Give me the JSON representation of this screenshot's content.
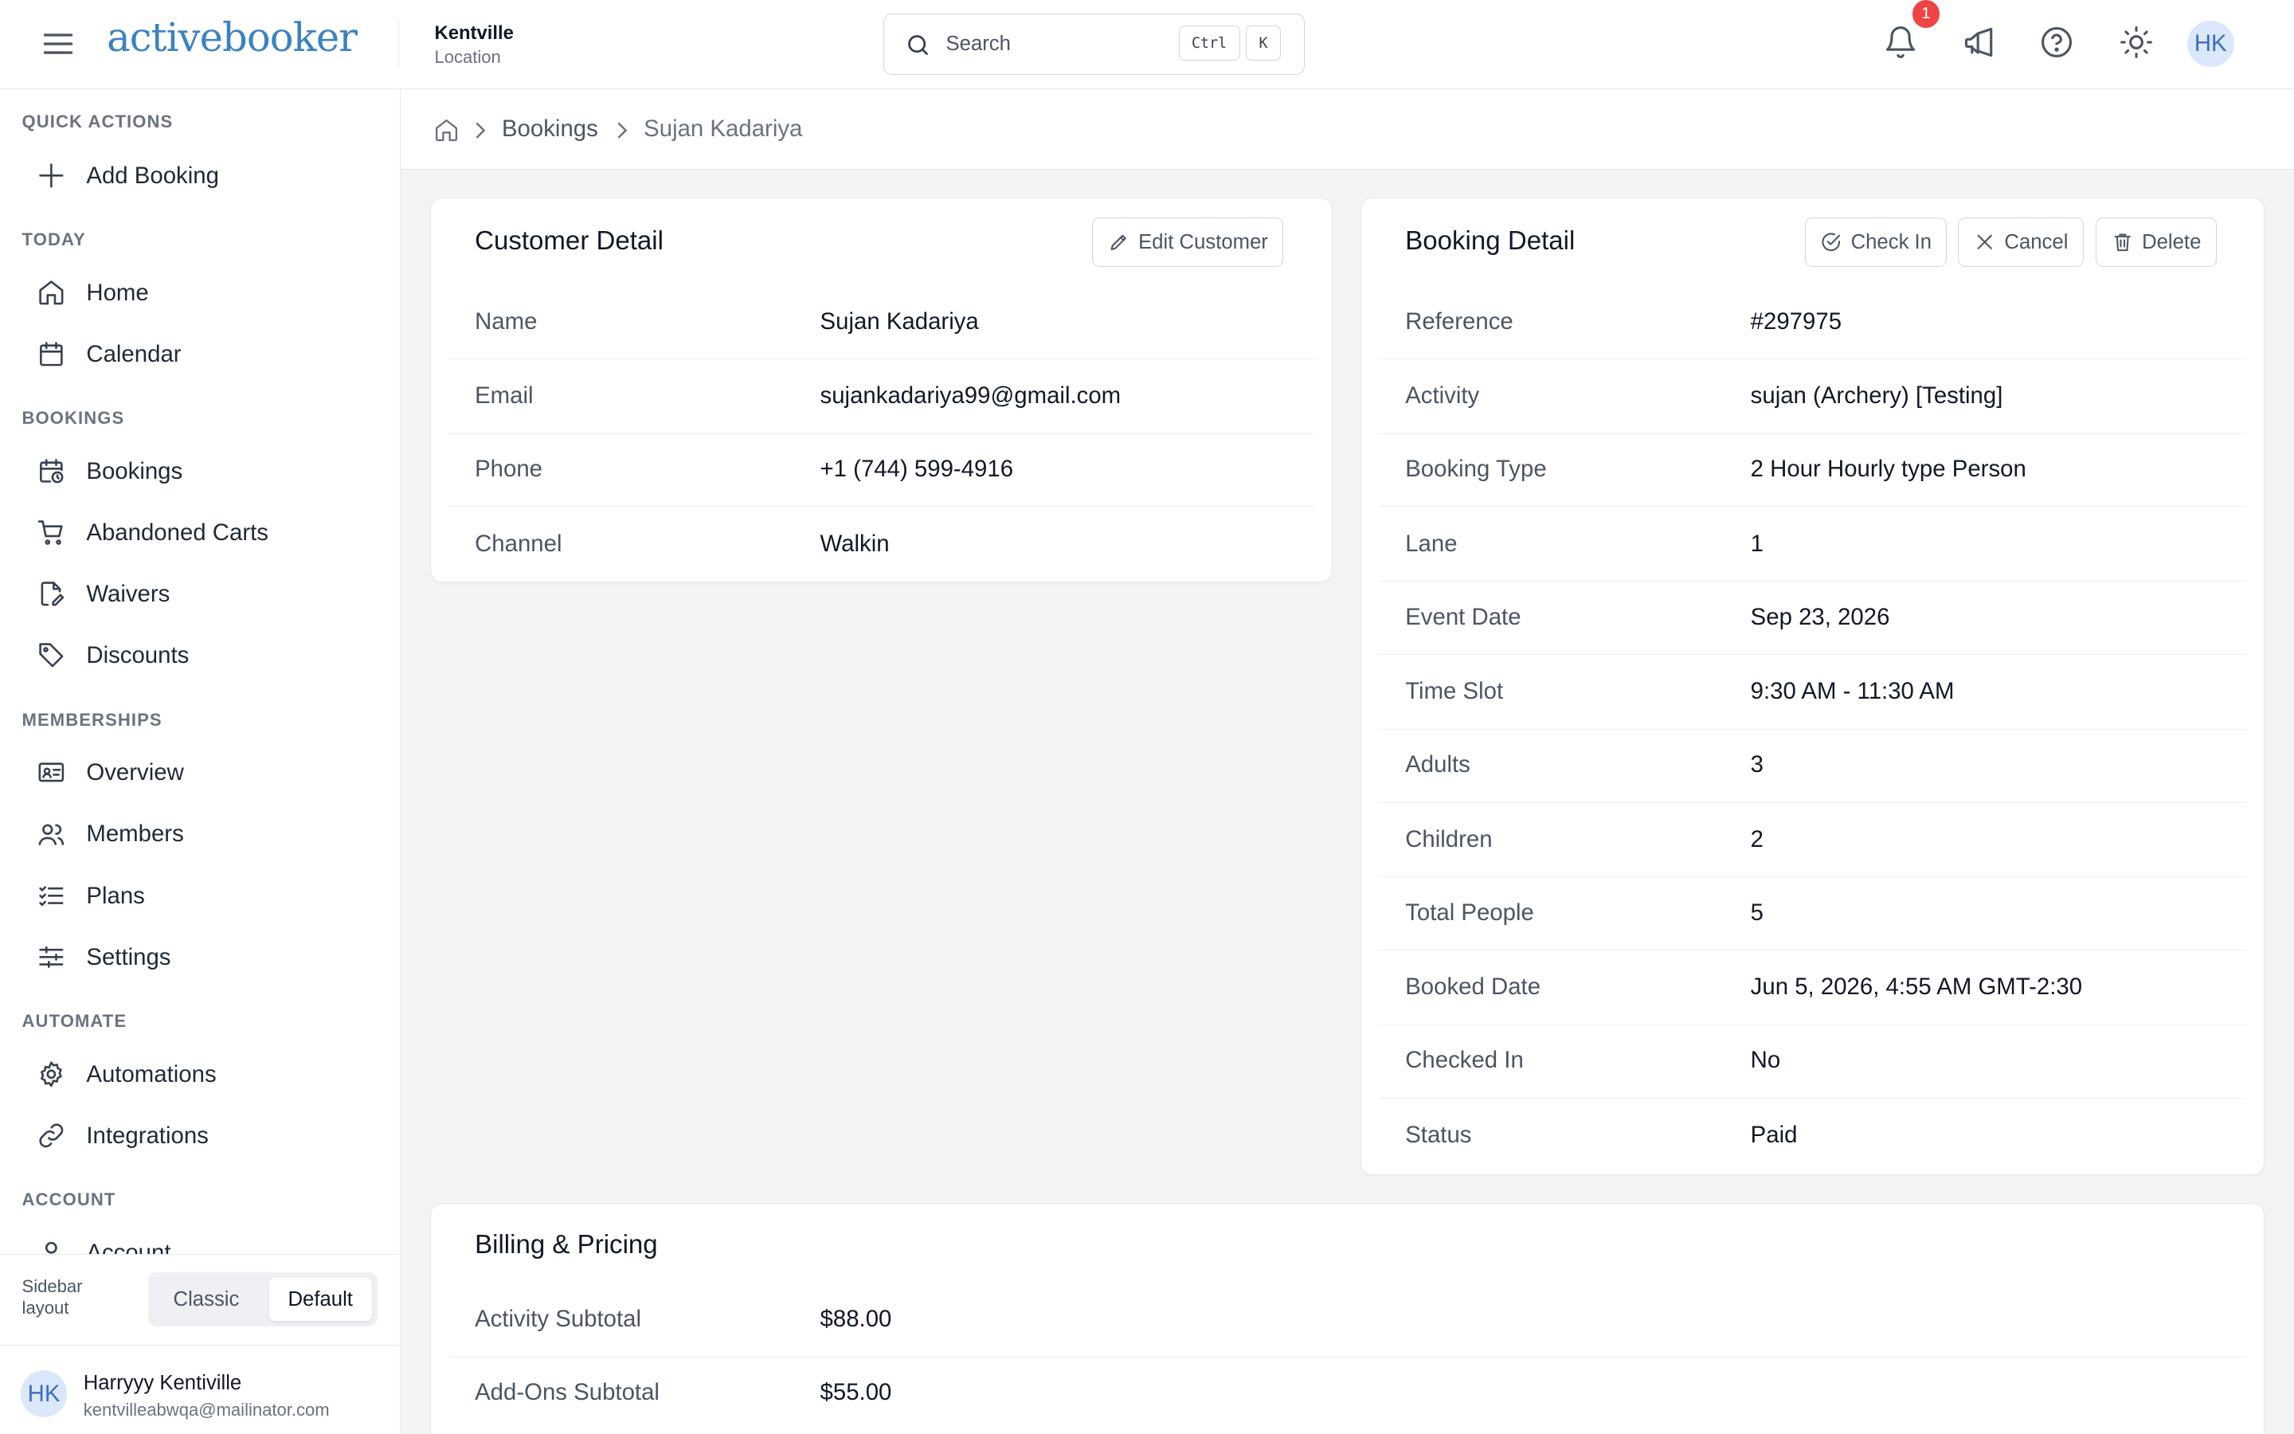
{
  "header": {
    "logo": "activebooker",
    "location_name": "Kentville",
    "location_label": "Location",
    "search_placeholder": "Search",
    "shortcut_ctrl": "Ctrl",
    "shortcut_key": "K",
    "notification_count": "1",
    "avatar_initials": "HK"
  },
  "sidebar": {
    "sections": [
      {
        "title": "QUICK ACTIONS",
        "items": [
          {
            "label": "Add Booking",
            "icon": "plus-icon"
          }
        ]
      },
      {
        "title": "TODAY",
        "items": [
          {
            "label": "Home",
            "icon": "home-icon"
          },
          {
            "label": "Calendar",
            "icon": "calendar-icon"
          }
        ]
      },
      {
        "title": "BOOKINGS",
        "items": [
          {
            "label": "Bookings",
            "icon": "calendar-clock-icon"
          },
          {
            "label": "Abandoned Carts",
            "icon": "cart-icon"
          },
          {
            "label": "Waivers",
            "icon": "file-signature-icon"
          },
          {
            "label": "Discounts",
            "icon": "tag-icon"
          }
        ]
      },
      {
        "title": "MEMBERSHIPS",
        "items": [
          {
            "label": "Overview",
            "icon": "id-card-icon"
          },
          {
            "label": "Members",
            "icon": "users-icon"
          },
          {
            "label": "Plans",
            "icon": "list-check-icon"
          },
          {
            "label": "Settings",
            "icon": "sliders-icon"
          }
        ]
      },
      {
        "title": "AUTOMATE",
        "items": [
          {
            "label": "Automations",
            "icon": "gear-icon"
          },
          {
            "label": "Integrations",
            "icon": "link-icon"
          }
        ]
      },
      {
        "title": "ACCOUNT",
        "items": [
          {
            "label": "Account",
            "icon": "user-icon"
          }
        ]
      }
    ],
    "layout_label": "Sidebar layout",
    "layout_options": [
      "Classic",
      "Default"
    ],
    "layout_selected": "Default",
    "user": {
      "initials": "HK",
      "name": "Harryyy Kentiville",
      "email": "kentvilleabwqa@mailinator.com"
    }
  },
  "breadcrumb": {
    "items": [
      "Bookings"
    ],
    "current": "Sujan Kadariya"
  },
  "customer": {
    "title": "Customer Detail",
    "edit_label": "Edit Customer",
    "rows": [
      {
        "label": "Name",
        "value": "Sujan Kadariya"
      },
      {
        "label": "Email",
        "value": "sujankadariya99@gmail.com"
      },
      {
        "label": "Phone",
        "value": "+1 (744) 599-4916"
      },
      {
        "label": "Channel",
        "value": "Walkin"
      }
    ]
  },
  "booking": {
    "title": "Booking Detail",
    "check_in_label": "Check In",
    "cancel_label": "Cancel",
    "delete_label": "Delete",
    "rows": [
      {
        "label": "Reference",
        "value": "#297975"
      },
      {
        "label": "Activity",
        "value": "sujan (Archery) [Testing]"
      },
      {
        "label": "Booking Type",
        "value": "2 Hour Hourly type Person"
      },
      {
        "label": "Lane",
        "value": "1"
      },
      {
        "label": "Event Date",
        "value": "Sep 23, 2026"
      },
      {
        "label": "Time Slot",
        "value": "9:30 AM - 11:30 AM"
      },
      {
        "label": "Adults",
        "value": "3"
      },
      {
        "label": "Children",
        "value": "2"
      },
      {
        "label": "Total People",
        "value": "5"
      },
      {
        "label": "Booked Date",
        "value": "Jun 5, 2026, 4:55 AM GMT-2:30"
      },
      {
        "label": "Checked In",
        "value": "No"
      },
      {
        "label": "Status",
        "value": "Paid"
      }
    ]
  },
  "billing": {
    "title": "Billing & Pricing",
    "rows": [
      {
        "label": "Activity Subtotal",
        "value": "$88.00"
      },
      {
        "label": "Add-Ons Subtotal",
        "value": "$55.00"
      }
    ]
  }
}
